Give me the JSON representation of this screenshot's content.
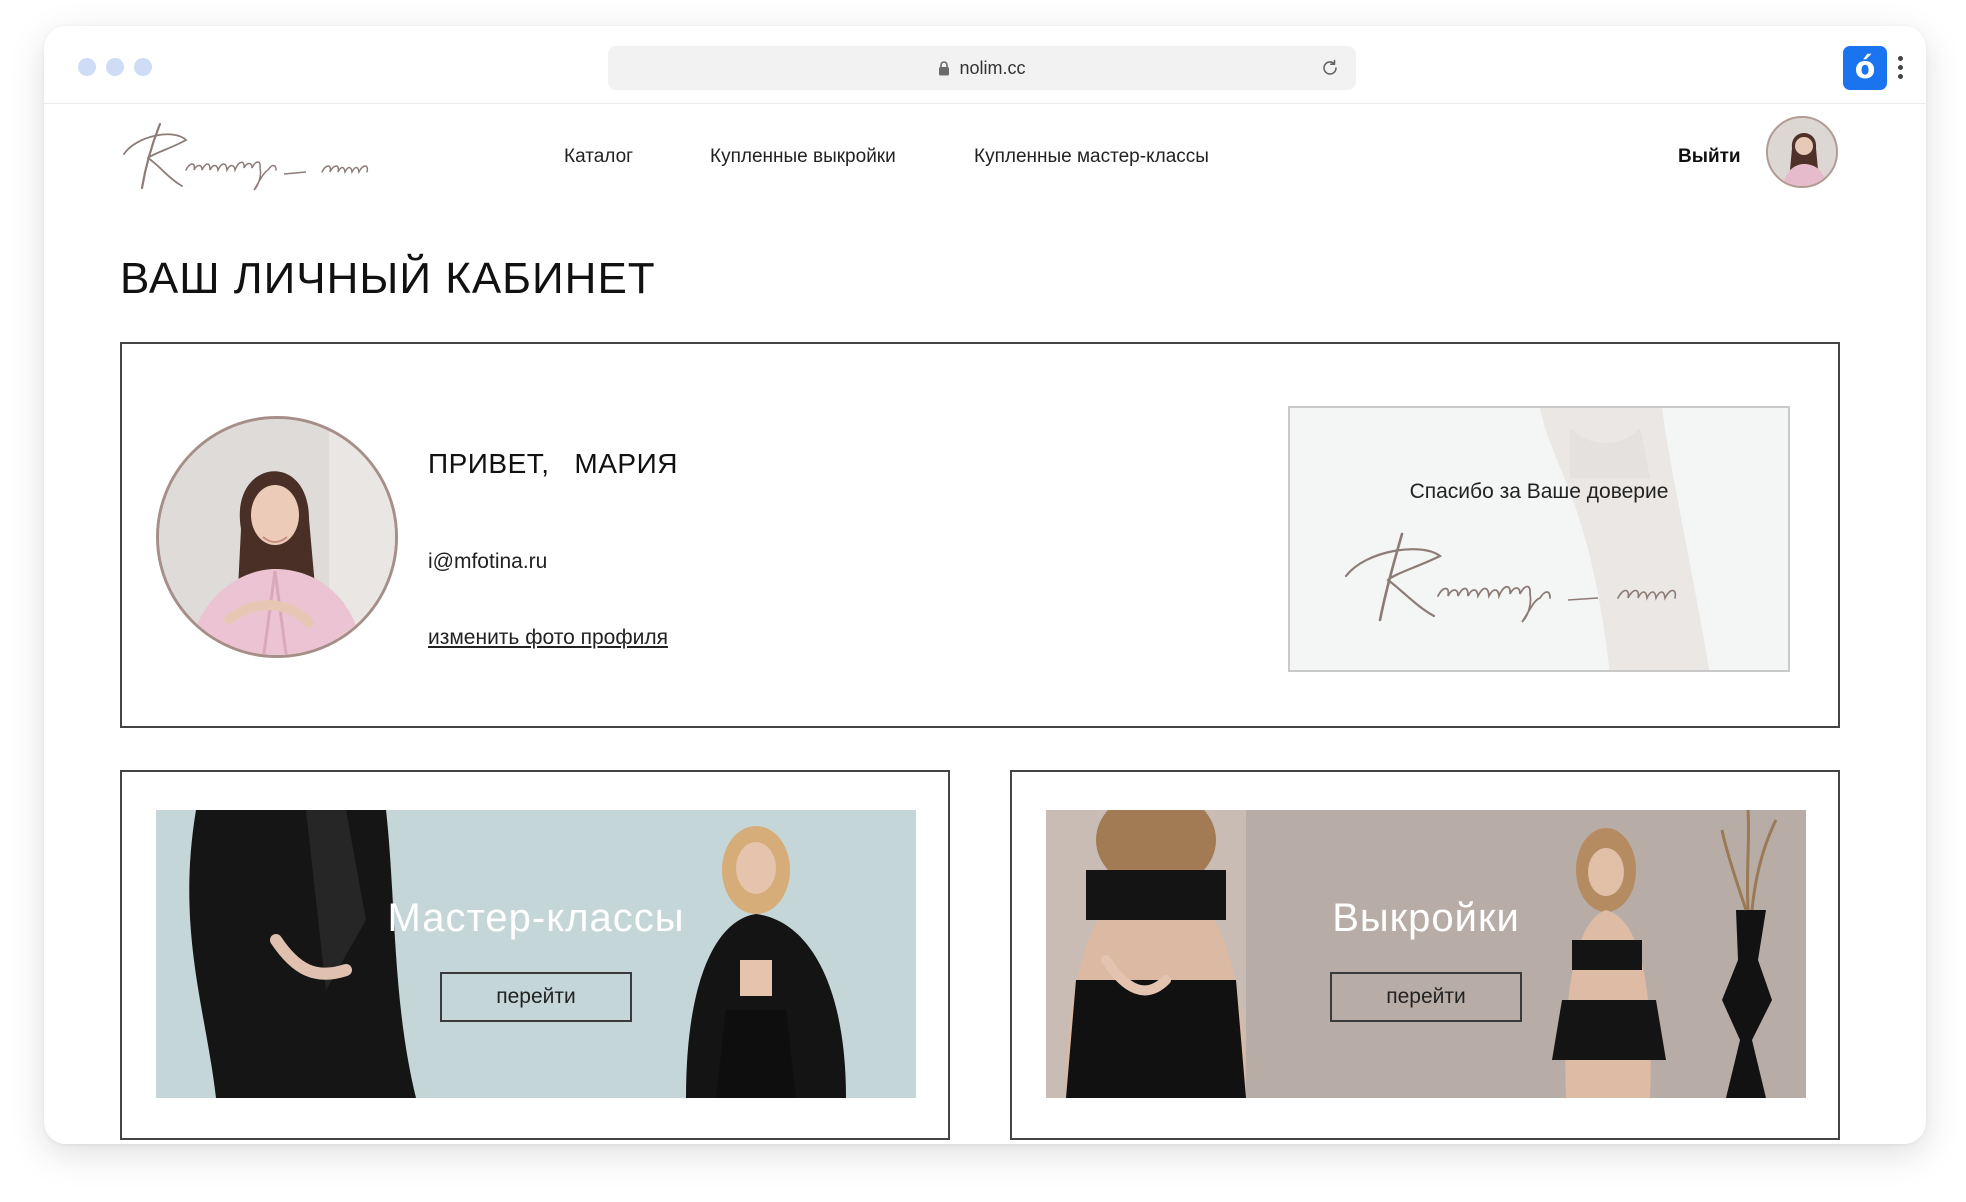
{
  "browser": {
    "url": "nolim.cc",
    "extension_letter": "ó",
    "colors": {
      "traffic": "#cfdcf6",
      "extension": "#1a74f0"
    }
  },
  "header": {
    "logo_text": "Kaminskaya sews",
    "nav": [
      {
        "label": "Каталог"
      },
      {
        "label": "Купленные выкройки"
      },
      {
        "label": "Купленные мастер-классы"
      }
    ],
    "logout_label": "Выйти"
  },
  "page": {
    "title": "ВАШ ЛИЧНЫЙ КАБИНЕТ"
  },
  "profile": {
    "greeting": "ПРИВЕТ,   МАРИЯ",
    "email": "i@mfotina.ru",
    "change_photo_label": "изменить фото профиля",
    "thanks_text": "Спасибо за Ваше доверие",
    "thanks_logo_text": "Kaminskaya sews"
  },
  "cards": [
    {
      "title": "Мастер-классы",
      "button_label": "перейти",
      "banner_color": "#c3d5d6"
    },
    {
      "title": "Выкройки",
      "button_label": "перейти",
      "banner_color": "#b9ada7"
    }
  ]
}
